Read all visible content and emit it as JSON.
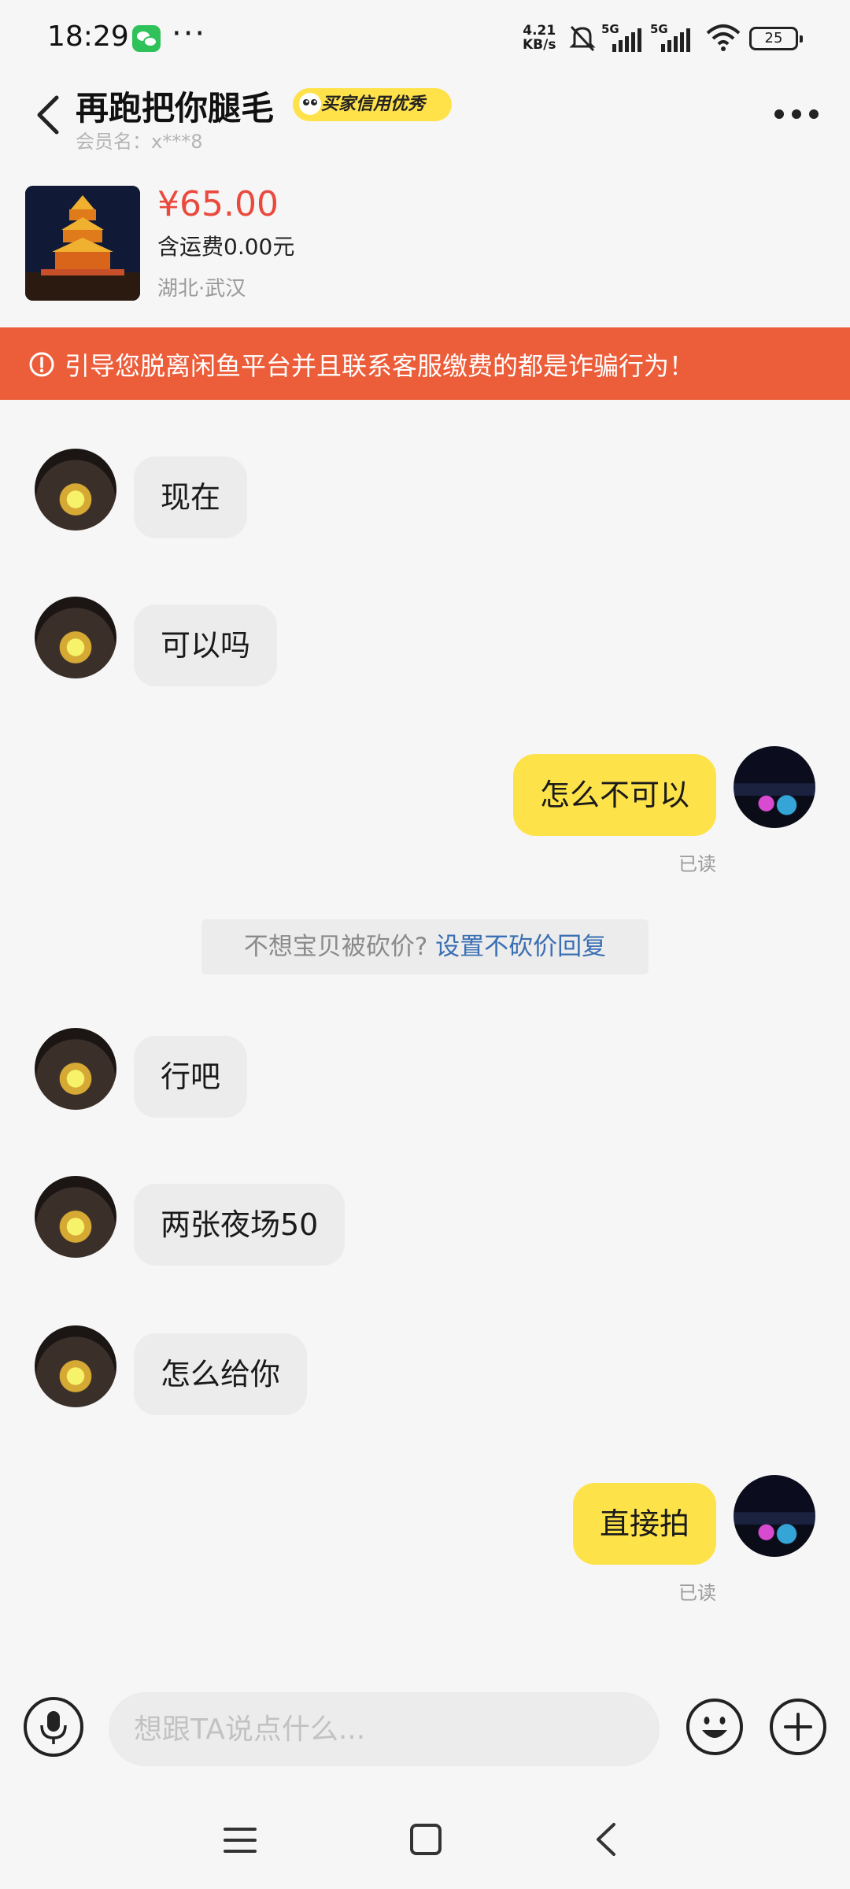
{
  "status_bar": {
    "time": "18:29",
    "net_speed_value": "4.21",
    "net_speed_unit": "KB/s",
    "sim1": "5G",
    "sim2": "5G",
    "battery": "25"
  },
  "header": {
    "title": "再跑把你腿毛",
    "badge": "买家信用优秀",
    "member_label": "会员名：x***8"
  },
  "product": {
    "price": "¥65.00",
    "shipping": "含运费0.00元",
    "location": "湖北·武汉"
  },
  "warning": {
    "text": "引导您脱离闲鱼平台并且联系客服缴费的都是诈骗行为！"
  },
  "messages": [
    {
      "side": "left",
      "text": "现在"
    },
    {
      "side": "left",
      "text": "可以吗"
    },
    {
      "side": "right",
      "text": "怎么不可以",
      "status": "已读"
    },
    {
      "side": "left",
      "text": "行吧"
    },
    {
      "side": "left",
      "text": "两张夜场50"
    },
    {
      "side": "left",
      "text": "怎么给你"
    },
    {
      "side": "right",
      "text": "直接拍",
      "status": "已读"
    }
  ],
  "tip": {
    "text": "不想宝贝被砍价? ",
    "link": "设置不砍价回复"
  },
  "input_bar": {
    "placeholder": "想跟TA说点什么..."
  },
  "icons": {
    "back": "chevron-left-icon",
    "more": "more-horizontal-icon",
    "mic": "microphone-icon",
    "emoji": "smiley-icon",
    "plus": "plus-circle-icon",
    "warning": "alert-circle-icon"
  },
  "colors": {
    "warning_bg": "#ec5d3a",
    "price": "#ea4a3d",
    "my_bubble": "#fde249",
    "their_bubble": "#ececec",
    "badge": "#ffe24a",
    "link": "#3a6fb3"
  }
}
